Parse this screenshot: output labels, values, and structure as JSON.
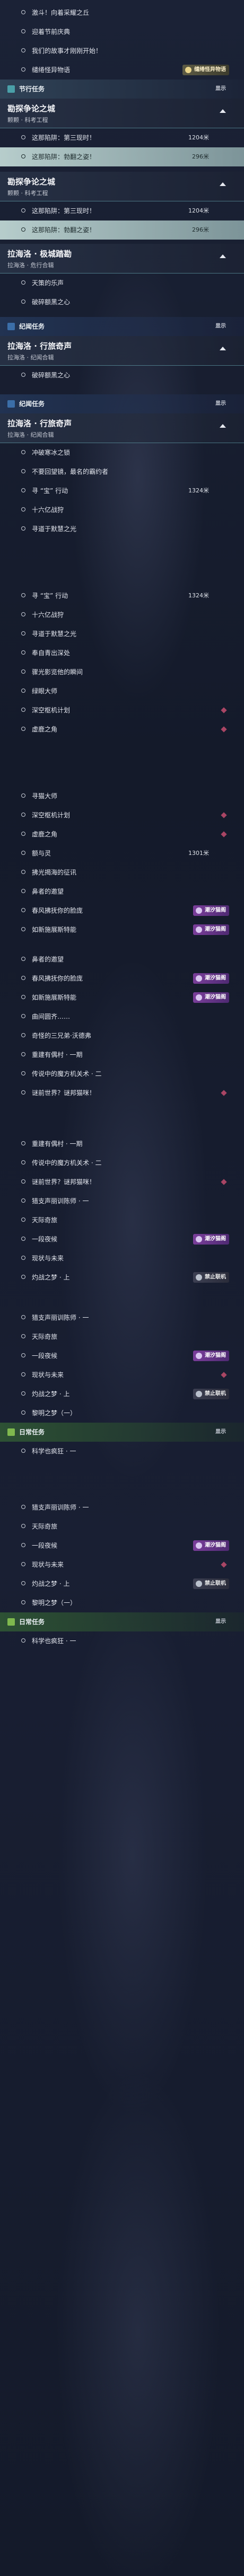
{
  "rows": [
    {
      "label": "激斗！向着采耀之丘"
    },
    {
      "label": "迎着节前庆典"
    },
    {
      "label": "我们的故事才刚刚开始！"
    },
    {
      "label": "缱绻怪异物语"
    }
  ],
  "badge_top": "缱绻怪异物语",
  "hdr1": {
    "title": "节行任务"
  },
  "g1": {
    "title": "勘探争论之城",
    "sub": "颗颗 · 科考工程"
  },
  "g1_rows": [
    {
      "label": "这那陷阱：第三现时！",
      "dist": "1204米"
    },
    {
      "label": "这那陷阱：勃翻之姿！",
      "dist": "296米",
      "sel": true
    }
  ],
  "g2": {
    "title": "勘探争论之城",
    "sub": "颗颗 · 科考工程"
  },
  "g2_rows": [
    {
      "label": "这那陷阱：第三现时！",
      "dist": "1204米"
    },
    {
      "label": "这那陷阱：勃翻之姿！",
      "dist": "296米",
      "sel": true
    }
  ],
  "g3": {
    "title": "拉海洛 · 极城踏勘",
    "sub": "拉海洛 · 危行合辑"
  },
  "g3_rows": [
    {
      "label": "天策的乐声"
    },
    {
      "label": "破碎额黑之心"
    }
  ],
  "hdr2": {
    "title": "纪闻任务"
  },
  "g4": {
    "title": "拉海洛 · 行旅奇声",
    "sub": "拉海洛 · 纪闻合辑"
  },
  "g4_rows": [
    {
      "label": "破碎额黑之心"
    }
  ],
  "hdr3": {
    "title": "纪闻任务"
  },
  "g5": {
    "title": "拉海洛 · 行旅奇声",
    "sub": "拉海洛 · 纪闻合辑"
  },
  "g5_rows": [
    {
      "label": "冲破寒冰之锁"
    },
    {
      "label": "不要回望镜，最名的霸约者"
    },
    {
      "label": "寻 “宝” 行动",
      "dist": "1324米"
    },
    {
      "label": "十六亿战狩"
    },
    {
      "label": "寻道于默慧之光"
    }
  ],
  "g6_rows": [
    {
      "label": "寻 “宝” 行动",
      "dist": "1324米"
    },
    {
      "label": "十六亿战狩"
    },
    {
      "label": "寻道于默慧之光"
    },
    {
      "label": "奉自青出深处"
    },
    {
      "label": "骤光影览他的瞬间"
    },
    {
      "label": "绿眼大师"
    },
    {
      "label": "深空枢机计划"
    },
    {
      "label": "虚鹿之角"
    }
  ],
  "g7_rows": [
    {
      "label": "寻猫大师"
    },
    {
      "label": "深空枢机计划"
    },
    {
      "label": "虚鹿之角"
    },
    {
      "label": "额与灵",
      "dist": "1301米"
    },
    {
      "label": "拂光揭海的征讯"
    },
    {
      "label": "鼻者的邀望"
    },
    {
      "label": "春风拂抚你的脸庞"
    },
    {
      "label": "如新施展斯特能"
    }
  ],
  "g8_rows": [
    {
      "label": "鼻者的邀望"
    },
    {
      "label": "春风拂抚你的脸庞"
    },
    {
      "label": "如新施展斯特能"
    },
    {
      "label": "曲间圆齐……"
    },
    {
      "label": "奇怪的三兄弟·沃德弗"
    },
    {
      "label": "重建有偶村 · 一期"
    },
    {
      "label": "传说中的魔方机关术 · 二"
    },
    {
      "label": "谜前世界？谜邦猫咪！"
    }
  ],
  "g9_rows": [
    {
      "label": "重建有偶村 · 一期"
    },
    {
      "label": "传说中的魔方机关术 · 二"
    },
    {
      "label": "谜前世界？谜邦猫咪！"
    },
    {
      "label": "猎支声丽训陈师 · 一"
    },
    {
      "label": "天际奇旅"
    },
    {
      "label": "一段夜候"
    },
    {
      "label": "现状与未来"
    },
    {
      "label": "灼战之梦 · 上"
    }
  ],
  "g10_rows": [
    {
      "label": "猎支声丽训陈师 · 一"
    },
    {
      "label": "天际奇旅"
    },
    {
      "label": "一段夜候"
    },
    {
      "label": "现状与未来"
    },
    {
      "label": "灼战之梦 · 上"
    },
    {
      "label": "黎明之梦（一）"
    }
  ],
  "hdr4": {
    "title": "日常任务"
  },
  "d1_rows": [
    {
      "label": "科学也疯狂 · 一"
    }
  ],
  "g11_rows": [
    {
      "label": "猎支声丽训陈师 · 一"
    },
    {
      "label": "天际奇旅"
    },
    {
      "label": "一段夜候"
    },
    {
      "label": "现状与未来"
    },
    {
      "label": "灼战之梦 · 上"
    },
    {
      "label": "黎明之梦（一）"
    }
  ],
  "hdr5": {
    "title": "日常任务"
  },
  "d2_rows": [
    {
      "label": "科学也疯狂 · 一"
    }
  ],
  "badge_purple": "潮汐猫阁",
  "badge_ban": "禁止联机",
  "toggle_show": "显示"
}
